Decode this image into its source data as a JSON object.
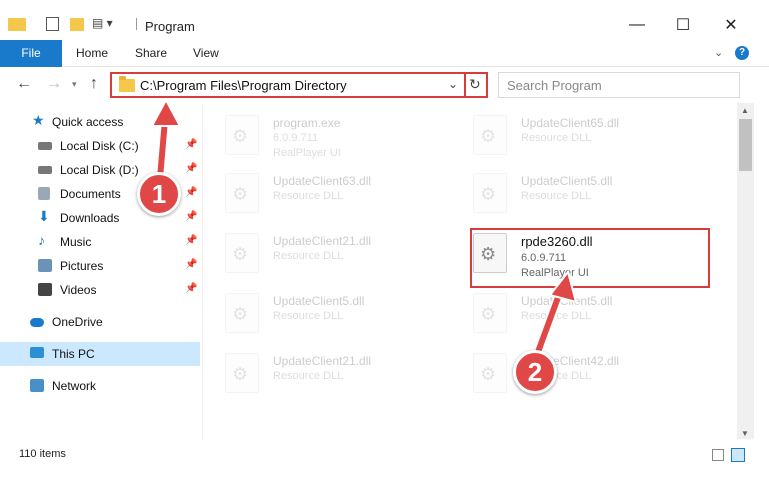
{
  "window": {
    "title": "Program"
  },
  "ribbon": {
    "tabs": [
      "File",
      "Home",
      "Share",
      "View"
    ]
  },
  "address": {
    "path": "C:\\Program Files\\Program Directory"
  },
  "search": {
    "placeholder": "Search Program"
  },
  "sidebar": {
    "items": [
      {
        "label": "Quick access"
      },
      {
        "label": "Local Disk (C:)"
      },
      {
        "label": "Local Disk (D:)"
      },
      {
        "label": "Documents"
      },
      {
        "label": "Downloads"
      },
      {
        "label": "Music"
      },
      {
        "label": "Pictures"
      },
      {
        "label": "Videos"
      },
      {
        "label": "OneDrive"
      },
      {
        "label": "This PC"
      },
      {
        "label": "Network"
      }
    ]
  },
  "files": [
    {
      "name": "program.exe",
      "line1": "6.0.9.711",
      "line2": "RealPlayer UI"
    },
    {
      "name": "UpdateClient65.dll",
      "line1": "Resource DLL"
    },
    {
      "name": "UpdateClient63.dll",
      "line1": "Resource DLL"
    },
    {
      "name": "UpdateClient5.dll",
      "line1": "Resource DLL"
    },
    {
      "name": "UpdateClient21.dll",
      "line1": "Resource DLL"
    },
    {
      "name": "rpde3260.dll",
      "line1": "6.0.9.711",
      "line2": "RealPlayer UI"
    },
    {
      "name": "UpdateClient5.dll",
      "line1": "Resource DLL"
    },
    {
      "name": "UpdateClient5.dll",
      "line1": "Resource DLL"
    },
    {
      "name": "UpdateClient21.dll",
      "line1": "Resource DLL"
    },
    {
      "name": "UpdateClient42.dll",
      "line1": "Resource DLL"
    }
  ],
  "status": {
    "item_count": "110 items"
  },
  "annotations": {
    "step1": "1",
    "step2": "2"
  },
  "colors": {
    "accent": "#1979ca",
    "highlight": "#d83b3b",
    "selected": "#cce8ff"
  }
}
